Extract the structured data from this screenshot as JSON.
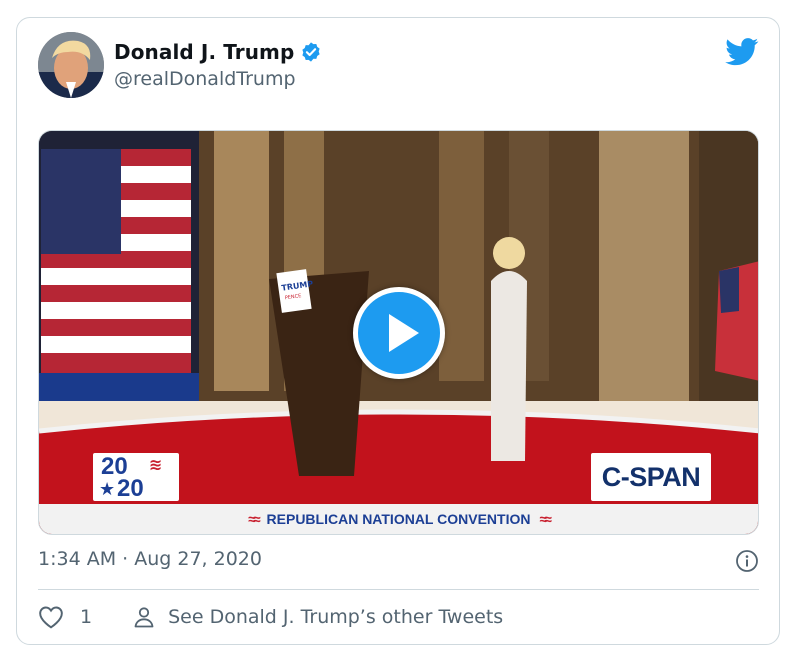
{
  "tweet": {
    "display_name": "Donald J. Trump",
    "handle": "@realDonaldTrump",
    "timestamp": "1:34 AM · Aug 27, 2020",
    "like_count": "1",
    "other_tweets_label": "See Donald J. Trump’s other Tweets"
  },
  "video": {
    "podium_sign_line1": "TRUMP",
    "podium_sign_line2": "PENCE",
    "logo_year_top": "20",
    "logo_year_bottom": "20",
    "network_logo": "C-SPAN",
    "bottom_banner": "REPUBLICAN NATIONAL CONVENTION"
  },
  "icons": {
    "verified": "verified-badge-icon",
    "brand": "twitter-bird-icon",
    "play": "play-icon",
    "info": "info-icon",
    "like": "heart-icon",
    "profile": "person-icon"
  },
  "colors": {
    "accent": "#1d9bf0",
    "text_primary": "#0f1419",
    "text_secondary": "#536471",
    "border": "#cfd9de"
  }
}
